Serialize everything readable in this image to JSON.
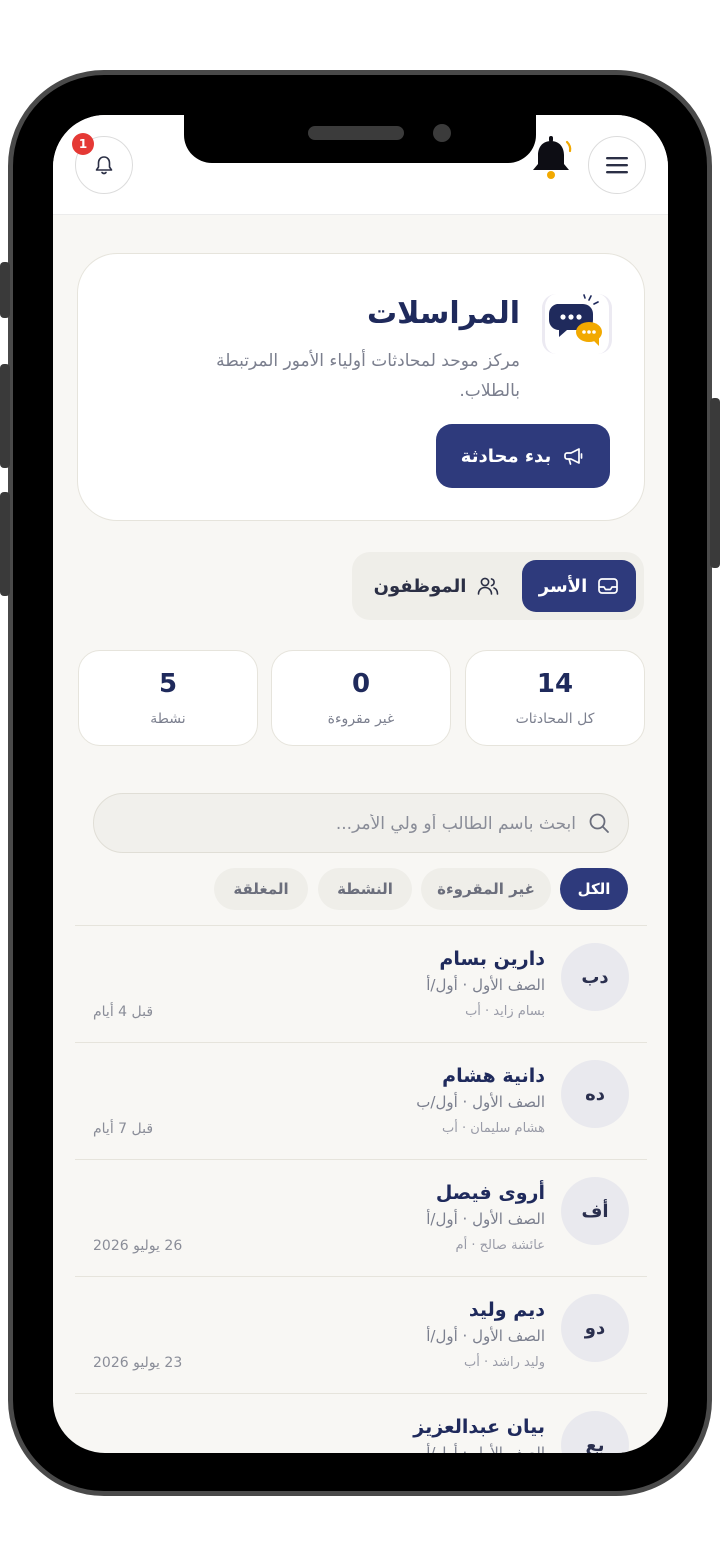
{
  "header": {
    "notification_count": "1"
  },
  "hero": {
    "title": "المراسلات",
    "description": "مركز موحد لمحادثات أولياء الأمور المرتبطة بالطلاب.",
    "start_button_label": "بدء محادثة"
  },
  "segments": [
    {
      "label": "الأسر",
      "active": true
    },
    {
      "label": "الموظفون",
      "active": false
    }
  ],
  "stats": [
    {
      "value": "14",
      "label": "كل المحادثات"
    },
    {
      "value": "0",
      "label": "غير مقروءة"
    },
    {
      "value": "5",
      "label": "نشطة"
    }
  ],
  "search": {
    "placeholder": "ابحث باسم الطالب أو ولي الأمر..."
  },
  "filters": [
    {
      "label": "الكل",
      "active": true
    },
    {
      "label": "غير المقروءة",
      "active": false
    },
    {
      "label": "النشطة",
      "active": false
    },
    {
      "label": "المغلقة",
      "active": false
    }
  ],
  "conversations": [
    {
      "initials": "دب",
      "name": "دارين بسام",
      "class": "الصف الأول · أول/أ",
      "parent": "بسام زايد · أب",
      "time": "قبل 4 أيام"
    },
    {
      "initials": "ده",
      "name": "دانية هشام",
      "class": "الصف الأول · أول/ب",
      "parent": "هشام سليمان · أب",
      "time": "قبل 7 أيام"
    },
    {
      "initials": "أف",
      "name": "أروى فيصل",
      "class": "الصف الأول · أول/أ",
      "parent": "عائشة صالح · أم",
      "time": "26 يوليو 2026"
    },
    {
      "initials": "دو",
      "name": "ديم وليد",
      "class": "الصف الأول · أول/أ",
      "parent": "وليد راشد · أب",
      "time": "23 يوليو 2026"
    },
    {
      "initials": "بع",
      "name": "بيان عبدالعزيز",
      "class": "الصف الأول · أول/أ",
      "parent": "",
      "time": ""
    }
  ],
  "colors": {
    "primary": "#2e3a7c",
    "accent": "#f2a900",
    "badge": "#e53935",
    "background": "#f8f7f4"
  }
}
